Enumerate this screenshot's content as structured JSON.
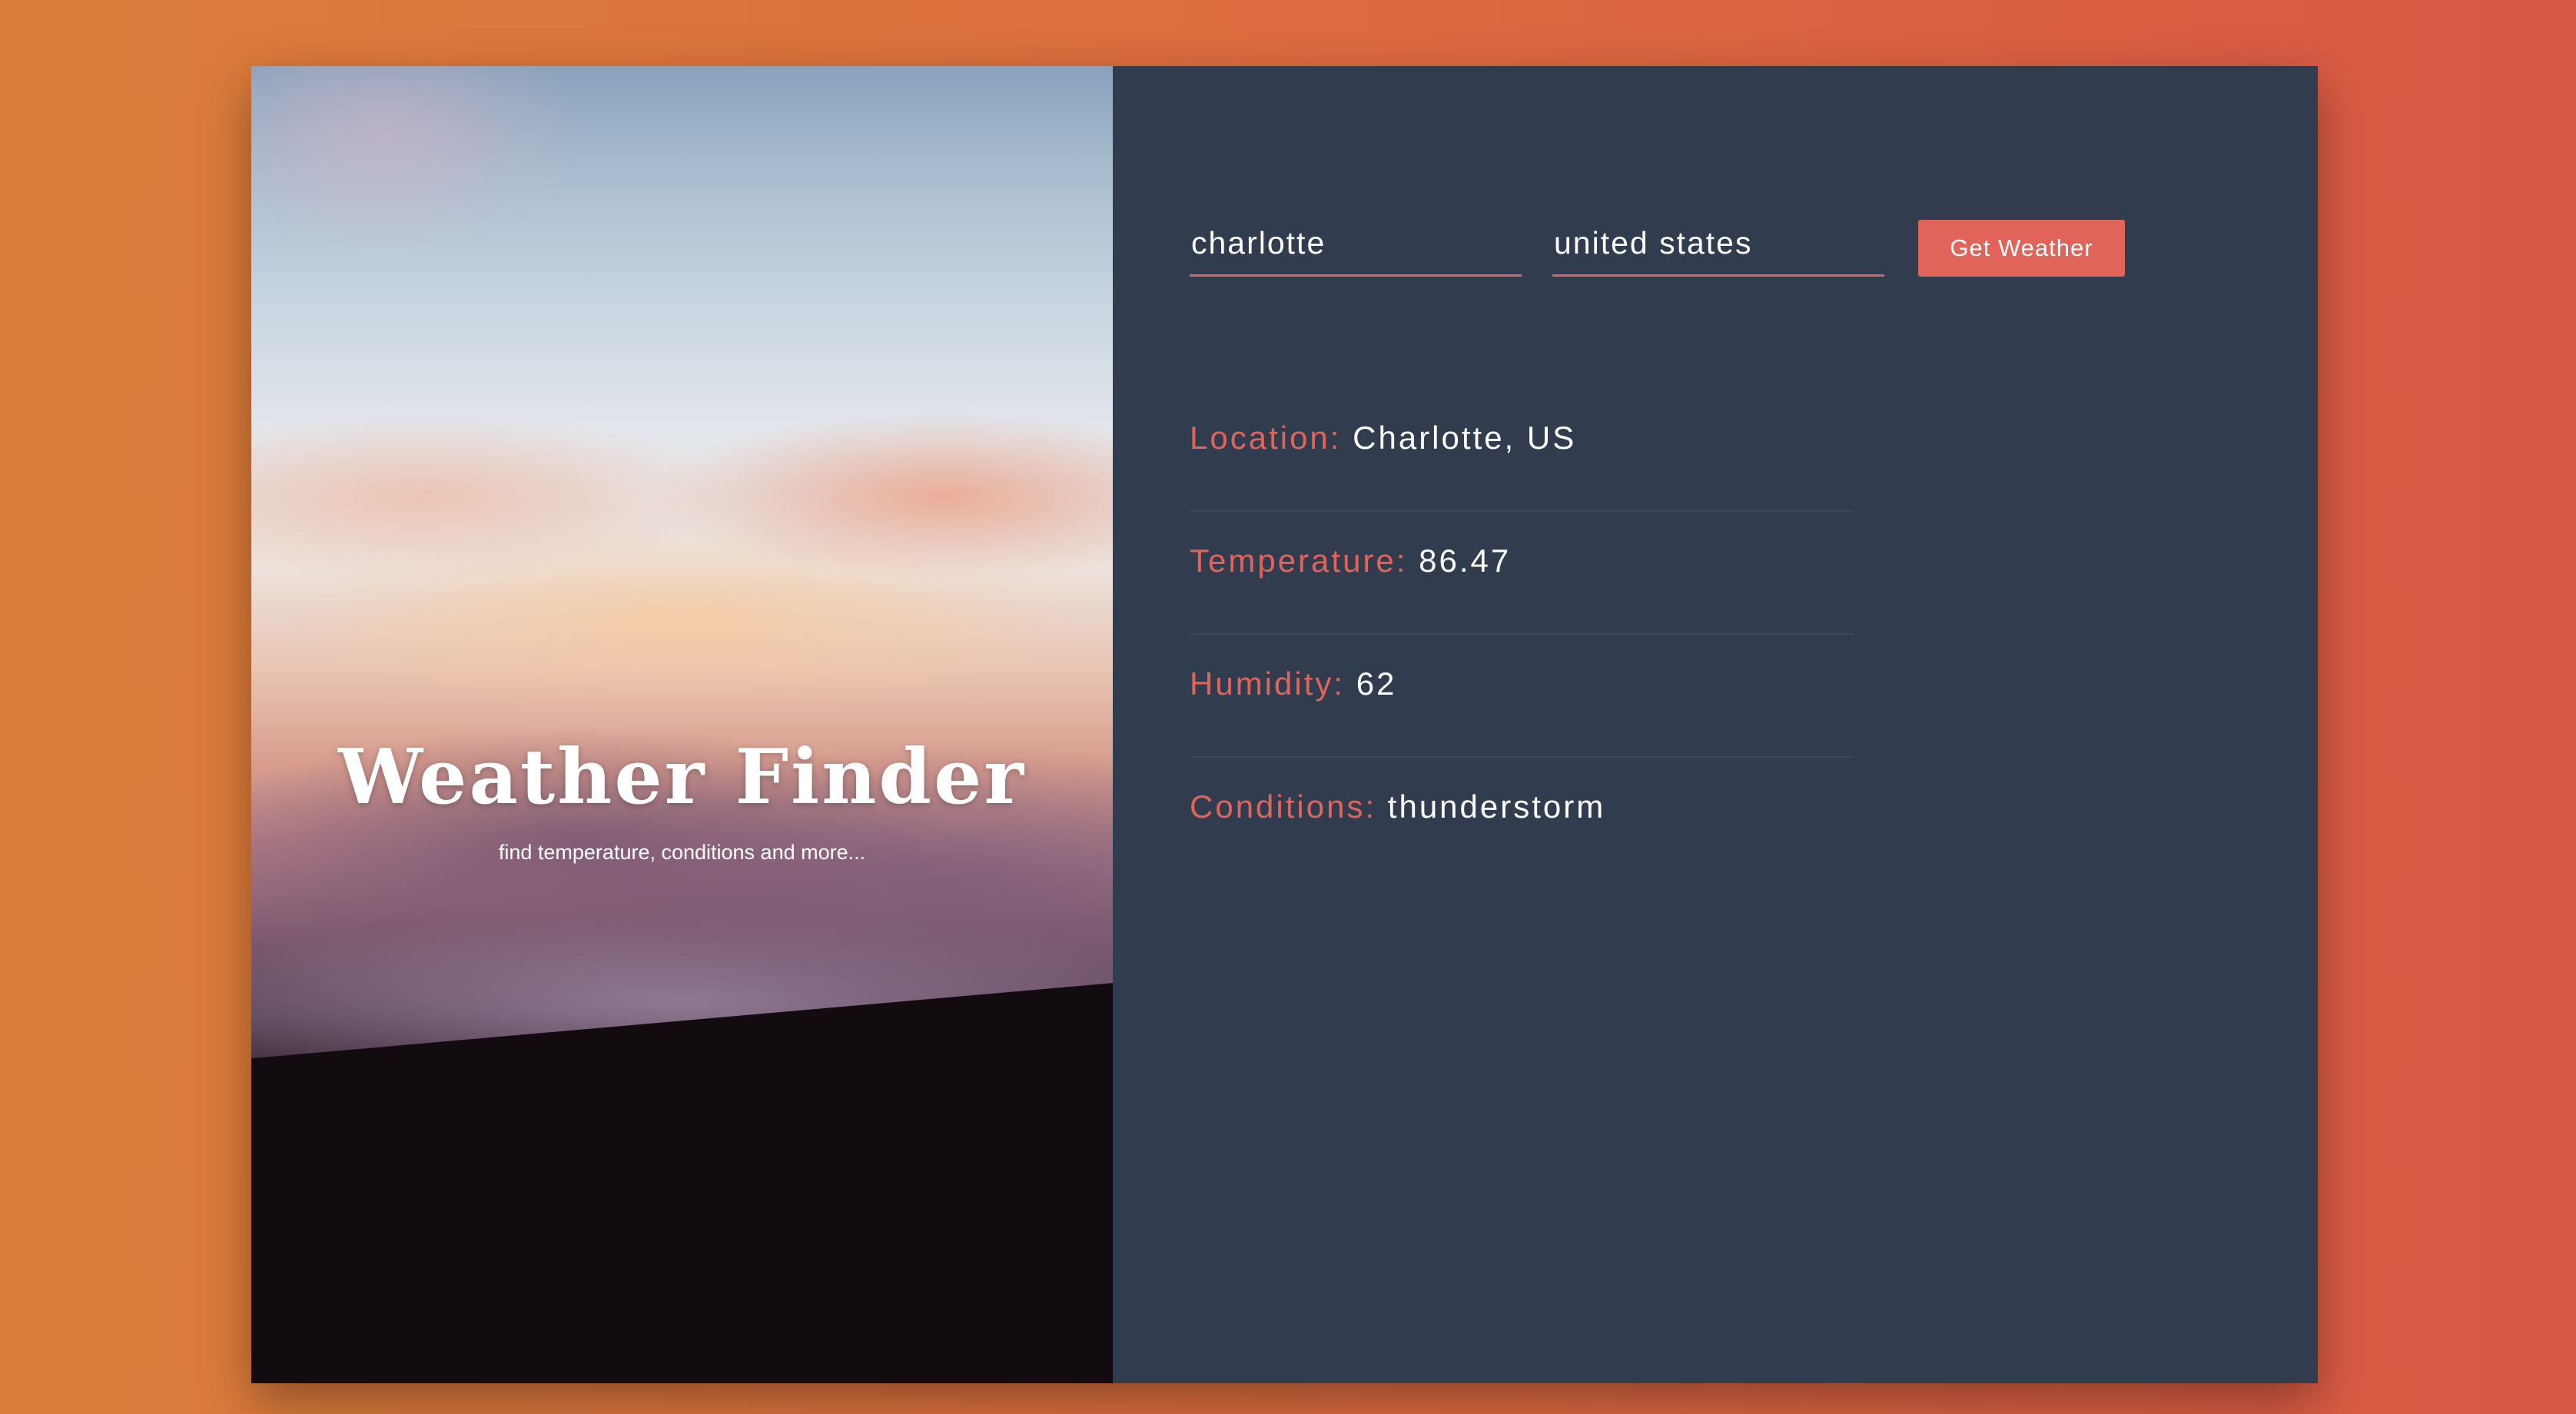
{
  "hero": {
    "title": "Weather Finder",
    "subtitle": "find temperature, conditions and more..."
  },
  "form": {
    "city_value": "charlotte",
    "country_value": "united states",
    "submit_label": "Get Weather"
  },
  "results": [
    {
      "label": "Location:",
      "value": "Charlotte, US"
    },
    {
      "label": "Temperature:",
      "value": "86.47"
    },
    {
      "label": "Humidity:",
      "value": "62"
    },
    {
      "label": "Conditions:",
      "value": "thunderstorm"
    }
  ],
  "colors": {
    "accent": "#e0645a",
    "panel_background": "#313d4f",
    "page_gradient_start": "#da7e3a",
    "page_gradient_end": "#d85744"
  }
}
